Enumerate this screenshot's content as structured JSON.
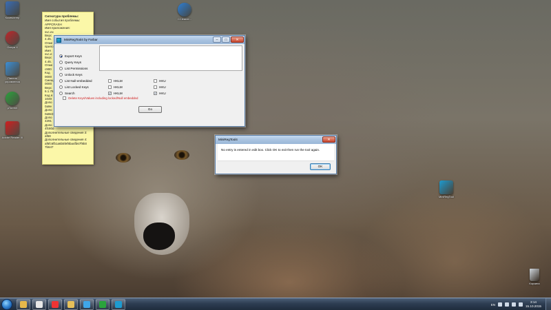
{
  "desktop": {
    "icons": [
      {
        "label": "Компьютер",
        "icon": "computer-icon",
        "color": "#3a6db5"
      },
      {
        "label": "Опера X",
        "icon": "opera-icon",
        "color": "#c0262a"
      },
      {
        "label": "Панель управления",
        "icon": "control-panel-icon",
        "color": "#3c8fd6"
      },
      {
        "label": "µTorrent",
        "icon": "utorrent-icon",
        "color": "#2aa33b"
      },
      {
        "label": "Adobe Reader XI",
        "icon": "adobe-reader-icon",
        "color": "#d11e1e"
      },
      {
        "label": "CCleaner...",
        "icon": "ccleaner-icon",
        "color": "#2d7fd6"
      },
      {
        "label": "MiniRegTool",
        "icon": "miniregtool-icon",
        "color": "#1d9bd0"
      },
      {
        "label": "Корзина",
        "icon": "recycle-bin-icon",
        "color": "#cfd7de"
      }
    ]
  },
  "sticky": {
    "header": "Сигнатура проблемы:",
    "lines": [
      "Имя события проблемы:",
      "APPCRASH",
      "Имя приложения:",
      "svc.ex",
      "Верс",
      "4.45.",
      "Отме",
      "прило",
      "Имя",
      "svc.e",
      "Верс",
      "4.45.",
      "Отме",
      "c900",
      "Код",
      "0000",
      "Смещ",
      "0000",
      "Верс",
      "6.1.76",
      "Код я",
      "1049",
      "Допо",
      "0a9e",
      "Допо",
      "0a9e3",
      "Допо",
      "4291",
      "Допо",
      "4fc80d",
      "Дополнительные сведения 3:",
      "af68",
      "Дополнительные сведения 4:",
      "af6fc6fb1a6b5fef8ba4fb67f9b0",
      "7b647"
    ]
  },
  "main_window": {
    "title": "MiniRegTool4 by Farbar",
    "minimize": "–",
    "maximize": "□",
    "close": "✕",
    "radios": [
      {
        "label": "Export Keys",
        "selected": true
      },
      {
        "label": "Query Keys",
        "selected": false
      },
      {
        "label": "List Permissions",
        "selected": false
      },
      {
        "label": "Unlock  Keys",
        "selected": false
      },
      {
        "label": "List Null-embedded",
        "selected": false
      },
      {
        "label": "List Locked Keys",
        "selected": false
      },
      {
        "label": "Search",
        "selected": false
      }
    ],
    "checkboxes": [
      {
        "label": "HKLM",
        "checked": false
      },
      {
        "label": "HKU",
        "checked": false
      },
      {
        "label": "HKLM",
        "checked": false
      },
      {
        "label": "HKU",
        "checked": false
      },
      {
        "label": "HKLM",
        "checked": true
      },
      {
        "label": "HKU",
        "checked": true
      }
    ],
    "check_mark": "✓",
    "warning": "Delete Keys/Values including locked/Null embedded",
    "warning_color": "#d01a1a",
    "go_label": "Go"
  },
  "msgbox": {
    "title": "MiniRegTool4",
    "message": "No entry is entered in edit box. Click OK to exit then run the tool again.",
    "close": "✕",
    "ok_label": "OK"
  },
  "taskbar": {
    "apps": [
      {
        "icon": "explorer-icon",
        "color": "#e6b84a"
      },
      {
        "icon": "yandex-browser-icon",
        "color": "#e8e8e8"
      },
      {
        "icon": "yandex-icon",
        "color": "#e33"
      },
      {
        "icon": "folder-icon",
        "color": "#e6c05a"
      },
      {
        "icon": "media-player-icon",
        "color": "#3fa6e8"
      },
      {
        "icon": "utorrent-icon",
        "color": "#2aa33b"
      },
      {
        "icon": "miniregtool-icon",
        "color": "#1d9bd0"
      }
    ],
    "language": "EN",
    "time": "3:14",
    "date": "15.10.2015"
  }
}
